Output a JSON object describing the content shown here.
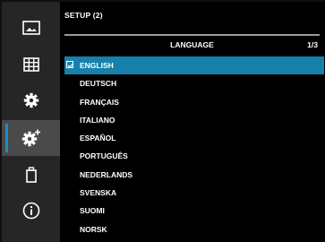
{
  "title": "SETUP (2)",
  "header": {
    "label": "LANGUAGE",
    "page": "1/3"
  },
  "scroll": {
    "position_fraction": 0.0,
    "visible_fraction": 1.0
  },
  "sidebar": {
    "items": [
      {
        "name": "playback-icon",
        "active": false
      },
      {
        "name": "grid-icon",
        "active": false
      },
      {
        "name": "gear-icon",
        "active": false
      },
      {
        "name": "gear-plus-icon",
        "active": true
      },
      {
        "name": "trash-icon",
        "active": false
      },
      {
        "name": "info-icon",
        "active": false
      }
    ]
  },
  "languages": [
    {
      "label": "ENGLISH",
      "selected": true
    },
    {
      "label": "DEUTSCH",
      "selected": false
    },
    {
      "label": "FRANÇAIS",
      "selected": false
    },
    {
      "label": "ITALIANO",
      "selected": false
    },
    {
      "label": "ESPAÑOL",
      "selected": false
    },
    {
      "label": "PORTUGUÊS",
      "selected": false
    },
    {
      "label": "NEDERLANDS",
      "selected": false
    },
    {
      "label": "SVENSKA",
      "selected": false
    },
    {
      "label": "SUOMI",
      "selected": false
    },
    {
      "label": "NORSK",
      "selected": false
    }
  ],
  "colors": {
    "accent": "#1681ab",
    "sidebar_bg": "#262626",
    "active_tab_bg": "#4a4a4a",
    "main_bg": "#000000",
    "text": "#ffffff"
  }
}
